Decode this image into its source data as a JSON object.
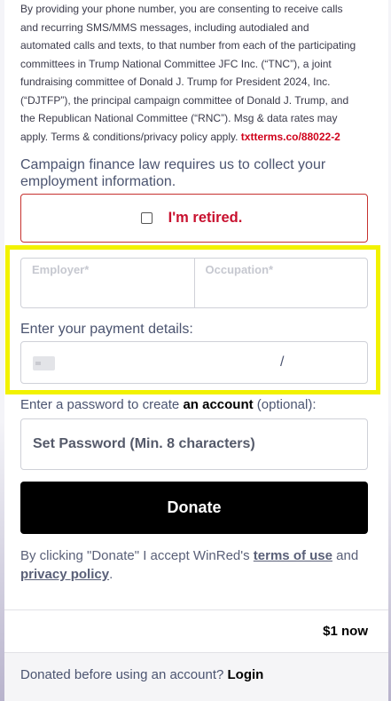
{
  "consent": {
    "text": "By providing your phone number, you are consenting to receive calls and recurring SMS/MMS messages, including autodialed and automated calls and texts, to that number from each of the participating committees in Trump National Committee JFC Inc. (“TNC”), a joint fundraising committee of Donald J. Trump for President 2024, Inc. (“DJTFP”), the principal campaign committee of Donald J. Trump, and the Republican National Committee (“RNC”). Msg & data rates may apply. Terms & conditions/privacy policy apply.",
    "link": "txtterms.co/88022-2"
  },
  "employment": {
    "notice": "Campaign finance law requires us to collect your employment information.",
    "retired_label": "I'm retired.",
    "retired_checked": false,
    "employer_placeholder": "Employer*",
    "occupation_placeholder": "Occupation*"
  },
  "payment": {
    "label": "Enter your payment details:",
    "expiry_separator": "/"
  },
  "account": {
    "label_prefix": "Enter a password to create",
    "label_bold": "an account",
    "label_suffix": "(optional):",
    "password_placeholder": "Set Password (Min. 8 characters)"
  },
  "donate": {
    "button_label": "Donate",
    "terms_prefix": "By clicking \"Donate\" I accept WinRed's",
    "terms_link": "terms of use",
    "terms_and": "and",
    "privacy_link": "privacy policy",
    "terms_end": "."
  },
  "summary": {
    "amount": "$1 now"
  },
  "footer": {
    "prompt": "Donated before using an account?",
    "login_link": "Login"
  },
  "colors": {
    "highlight": "#f2f200",
    "retired_red": "#c8102e",
    "button": "#000000"
  }
}
